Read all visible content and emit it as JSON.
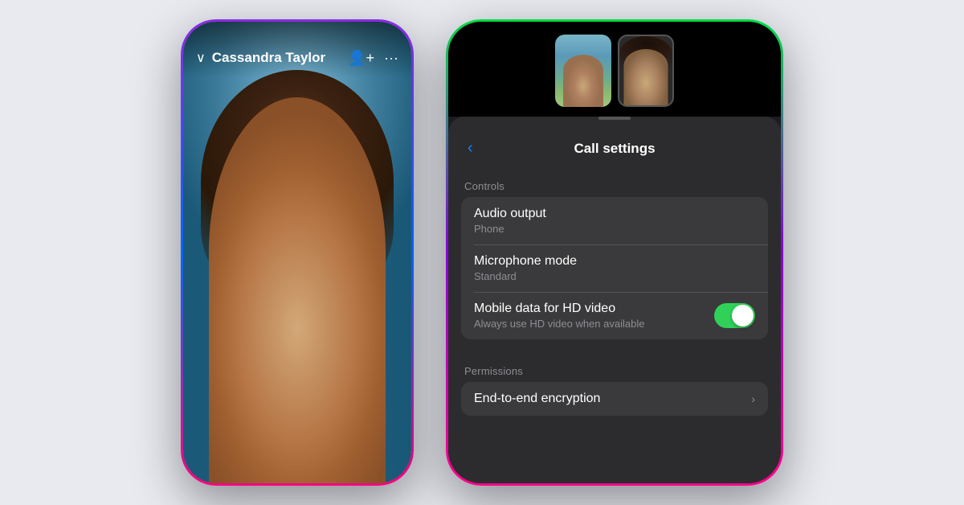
{
  "leftPhone": {
    "callerName": "Cassandra Taylor",
    "chevron": "∨",
    "addPerson": "⊕",
    "more": "···"
  },
  "rightPhone": {
    "settingsTitle": "Call settings",
    "backLabel": "‹",
    "notch": "",
    "controls": {
      "sectionLabel": "Controls",
      "rows": [
        {
          "title": "Audio output",
          "subtitle": "Phone",
          "type": "nav"
        },
        {
          "title": "Microphone mode",
          "subtitle": "Standard",
          "type": "nav"
        },
        {
          "title": "Mobile data for HD video",
          "subtitle": "Always use HD video when available",
          "type": "toggle",
          "value": true
        }
      ]
    },
    "permissions": {
      "sectionLabel": "Permissions",
      "rows": [
        {
          "title": "End-to-end encryption",
          "type": "nav"
        }
      ]
    }
  }
}
